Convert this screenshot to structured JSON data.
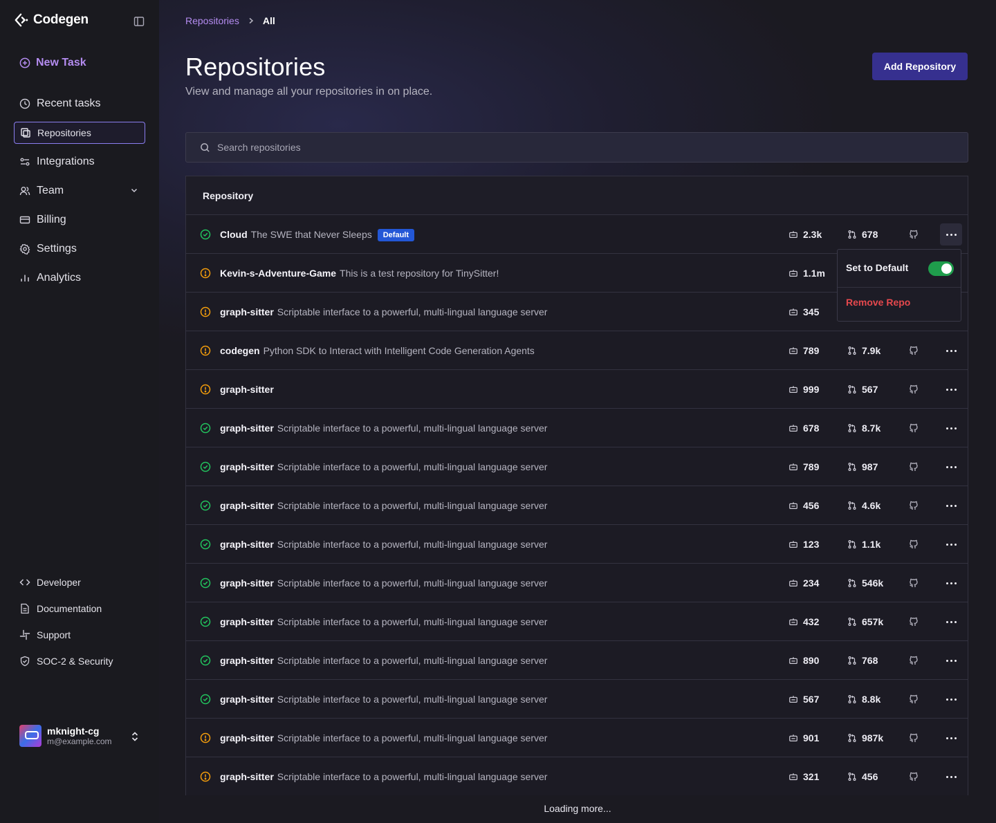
{
  "app": {
    "name": "Codegen"
  },
  "sidebar": {
    "new_task_label": "New Task",
    "items": [
      {
        "label": "Recent tasks",
        "icon": "clock-icon",
        "active": false
      },
      {
        "label": "Repositories",
        "icon": "repo-icon",
        "active": true
      },
      {
        "label": "Integrations",
        "icon": "integrations-icon",
        "active": false
      },
      {
        "label": "Team",
        "icon": "team-icon",
        "active": false,
        "expandable": true
      },
      {
        "label": "Billing",
        "icon": "billing-icon",
        "active": false
      },
      {
        "label": "Settings",
        "icon": "gear-icon",
        "active": false
      },
      {
        "label": "Analytics",
        "icon": "analytics-icon",
        "active": false
      }
    ],
    "bottom_items": [
      {
        "label": "Developer",
        "icon": "code-icon"
      },
      {
        "label": "Documentation",
        "icon": "document-icon"
      },
      {
        "label": "Support",
        "icon": "slack-icon"
      },
      {
        "label": "SOC-2 & Security",
        "icon": "shield-icon"
      }
    ],
    "user": {
      "name": "mknight-cg",
      "email": "m@example.com"
    }
  },
  "breadcrumb": {
    "parent": "Repositories",
    "current": "All"
  },
  "header": {
    "title": "Repositories",
    "subtitle": "View and manage all your repositories in on place.",
    "add_button_label": "Add Repository"
  },
  "search": {
    "placeholder": "Search repositories",
    "value": ""
  },
  "table": {
    "column_header": "Repository",
    "rows": [
      {
        "status": "success",
        "name": "Cloud",
        "description": "The SWE that Never Sleeps",
        "badge": "Default",
        "stat1": "2.3k",
        "stat2": "678"
      },
      {
        "status": "warning",
        "name": "Kevin-s-Adventure-Game",
        "description": "This is a test repository for TinySitter!",
        "badge": "",
        "stat1": "1.1m",
        "stat2": ""
      },
      {
        "status": "warning",
        "name": "graph-sitter",
        "description": "Scriptable interface to a powerful, multi-lingual language server",
        "badge": "",
        "stat1": "345",
        "stat2": ""
      },
      {
        "status": "warning",
        "name": "codegen",
        "description": "Python SDK to Interact with Intelligent Code Generation Agents",
        "badge": "",
        "stat1": "789",
        "stat2": "7.9k"
      },
      {
        "status": "warning",
        "name": "graph-sitter",
        "description": "",
        "badge": "",
        "stat1": "999",
        "stat2": "567"
      },
      {
        "status": "success",
        "name": "graph-sitter",
        "description": "Scriptable interface to a powerful, multi-lingual language server",
        "badge": "",
        "stat1": "678",
        "stat2": "8.7k"
      },
      {
        "status": "success",
        "name": "graph-sitter",
        "description": "Scriptable interface to a powerful, multi-lingual language server",
        "badge": "",
        "stat1": "789",
        "stat2": "987"
      },
      {
        "status": "success",
        "name": "graph-sitter",
        "description": "Scriptable interface to a powerful, multi-lingual language server",
        "badge": "",
        "stat1": "456",
        "stat2": "4.6k"
      },
      {
        "status": "success",
        "name": "graph-sitter",
        "description": "Scriptable interface to a powerful, multi-lingual language server",
        "badge": "",
        "stat1": "123",
        "stat2": "1.1k"
      },
      {
        "status": "success",
        "name": "graph-sitter",
        "description": "Scriptable interface to a powerful, multi-lingual language server",
        "badge": "",
        "stat1": "234",
        "stat2": "546k"
      },
      {
        "status": "success",
        "name": "graph-sitter",
        "description": "Scriptable interface to a powerful, multi-lingual language server",
        "badge": "",
        "stat1": "432",
        "stat2": "657k"
      },
      {
        "status": "success",
        "name": "graph-sitter",
        "description": "Scriptable interface to a powerful, multi-lingual language server",
        "badge": "",
        "stat1": "890",
        "stat2": "768"
      },
      {
        "status": "success",
        "name": "graph-sitter",
        "description": "Scriptable interface to a powerful, multi-lingual language server",
        "badge": "",
        "stat1": "567",
        "stat2": "8.8k"
      },
      {
        "status": "warning",
        "name": "graph-sitter",
        "description": "Scriptable interface to a powerful, multi-lingual language server",
        "badge": "",
        "stat1": "901",
        "stat2": "987k"
      },
      {
        "status": "warning",
        "name": "graph-sitter",
        "description": "Scriptable interface to a powerful, multi-lingual language server",
        "badge": "",
        "stat1": "321",
        "stat2": "456"
      }
    ]
  },
  "context_menu": {
    "set_default_label": "Set to Default",
    "set_default_on": true,
    "remove_label": "Remove Repo"
  },
  "loading_text": "Loading more...",
  "colors": {
    "accent": "#b48cf0",
    "primary_button": "#36308f",
    "success": "#22c55e",
    "warning": "#f59e0b",
    "danger": "#e5484d",
    "badge": "#2357d6",
    "toggle_on": "#1f9d4c"
  }
}
